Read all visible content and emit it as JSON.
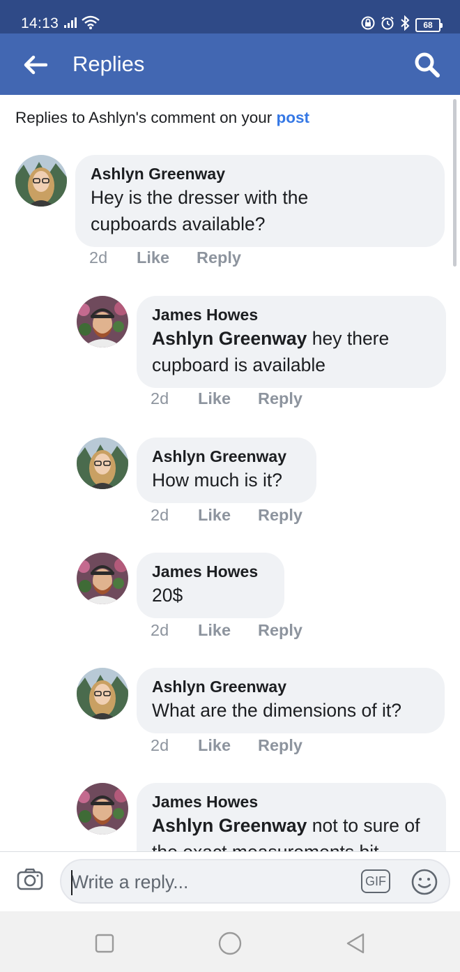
{
  "status_bar": {
    "time": "14:13",
    "battery": "68"
  },
  "app_bar": {
    "title": "Replies",
    "back_icon": "arrow-left-icon",
    "search_icon": "search-icon"
  },
  "header": {
    "prefix": "Replies to Ashlyn's comment on your ",
    "link": "post"
  },
  "colors": {
    "status_bar": "#2f4a87",
    "app_bar": "#4267b2",
    "link": "#3578e5",
    "bubble": "#f0f2f5",
    "muted": "#8d949e"
  },
  "comments": [
    {
      "author": "Ashlyn Greenway",
      "avatar": "ashlyn-avatar",
      "mention": "",
      "text": "Hey is the dresser with the cupboards available?",
      "time": "2d",
      "like": "Like",
      "reply": "Reply"
    },
    {
      "author": "James Howes",
      "avatar": "james-avatar",
      "mention": "Ashlyn Greenway",
      "text": " hey there cupboard is available",
      "time": "2d",
      "like": "Like",
      "reply": "Reply"
    },
    {
      "author": "Ashlyn Greenway",
      "avatar": "ashlyn-avatar",
      "mention": "",
      "text": "How much is it?",
      "time": "2d",
      "like": "Like",
      "reply": "Reply"
    },
    {
      "author": "James Howes",
      "avatar": "james-avatar",
      "mention": "",
      "text": "20$",
      "time": "2d",
      "like": "Like",
      "reply": "Reply"
    },
    {
      "author": "Ashlyn Greenway",
      "avatar": "ashlyn-avatar",
      "mention": "",
      "text": "What are the dimensions of it?",
      "time": "2d",
      "like": "Like",
      "reply": "Reply"
    },
    {
      "author": "James Howes",
      "avatar": "james-avatar",
      "mention": "Ashlyn Greenway",
      "text": " not to sure of the exact measurements bit",
      "time": "",
      "like": "",
      "reply": ""
    }
  ],
  "reply_bar": {
    "placeholder": "Write a reply...",
    "gif_label": "GIF",
    "camera_icon": "camera-icon",
    "emoji_icon": "emoji-icon"
  },
  "nav_bar": {
    "recents_icon": "square-icon",
    "home_icon": "circle-icon",
    "back_icon": "triangle-back-icon"
  }
}
